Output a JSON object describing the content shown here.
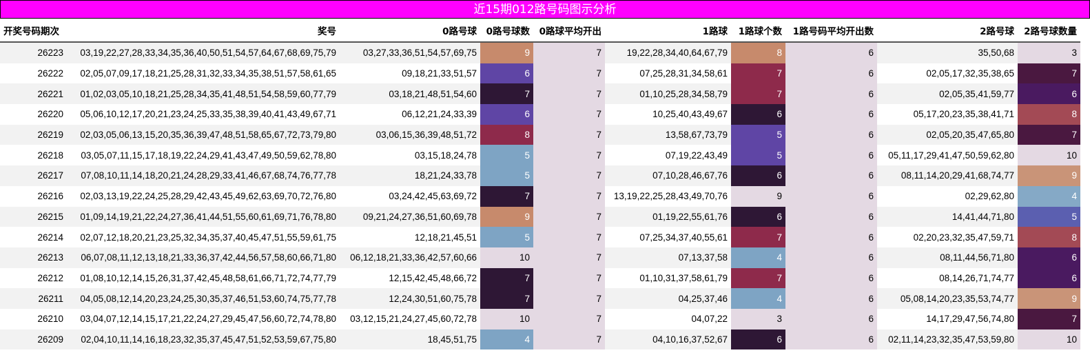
{
  "title": "近15期012路号码图示分析",
  "headers": [
    "开奖号码期次",
    "奖号",
    "0路号球",
    "0路号球数",
    "0路球平均开出",
    "1路球",
    "1路球个数",
    "1路号码平均开出数",
    "2路号球",
    "2路号球数量"
  ],
  "rows": [
    {
      "issue": "26223",
      "numbers": "03,19,22,27,28,33,34,35,36,40,50,51,54,57,64,67,68,69,75,79",
      "r0": "03,27,33,36,51,54,57,69,75",
      "c0": "9",
      "a0": "7",
      "r1": "19,22,28,34,40,64,67,79",
      "c1": "8",
      "a1": "6",
      "r2": "35,50,68",
      "c2": "3"
    },
    {
      "issue": "26222",
      "numbers": "02,05,07,09,17,18,21,25,28,31,32,33,34,35,38,51,57,58,61,65",
      "r0": "09,18,21,33,51,57",
      "c0": "6",
      "a0": "7",
      "r1": "07,25,28,31,34,58,61",
      "c1": "7",
      "a1": "6",
      "r2": "02,05,17,32,35,38,65",
      "c2": "7"
    },
    {
      "issue": "26221",
      "numbers": "01,02,03,05,10,18,21,25,28,34,35,41,48,51,54,58,59,60,77,79",
      "r0": "03,18,21,48,51,54,60",
      "c0": "7",
      "a0": "7",
      "r1": "01,10,25,28,34,58,79",
      "c1": "7",
      "a1": "6",
      "r2": "02,05,35,41,59,77",
      "c2": "6"
    },
    {
      "issue": "26220",
      "numbers": "05,06,10,12,17,20,21,23,24,25,33,35,38,39,40,41,43,49,67,71",
      "r0": "06,12,21,24,33,39",
      "c0": "6",
      "a0": "7",
      "r1": "10,25,40,43,49,67",
      "c1": "6",
      "a1": "6",
      "r2": "05,17,20,23,35,38,41,71",
      "c2": "8"
    },
    {
      "issue": "26219",
      "numbers": "02,03,05,06,13,15,20,35,36,39,47,48,51,58,65,67,72,73,79,80",
      "r0": "03,06,15,36,39,48,51,72",
      "c0": "8",
      "a0": "7",
      "r1": "13,58,67,73,79",
      "c1": "5",
      "a1": "6",
      "r2": "02,05,20,35,47,65,80",
      "c2": "7"
    },
    {
      "issue": "26218",
      "numbers": "03,05,07,11,15,17,18,19,22,24,29,41,43,47,49,50,59,62,78,80",
      "r0": "03,15,18,24,78",
      "c0": "5",
      "a0": "7",
      "r1": "07,19,22,43,49",
      "c1": "5",
      "a1": "6",
      "r2": "05,11,17,29,41,47,50,59,62,80",
      "c2": "10"
    },
    {
      "issue": "26217",
      "numbers": "07,08,10,11,14,18,20,21,24,28,29,33,41,46,67,68,74,76,77,78",
      "r0": "18,21,24,33,78",
      "c0": "5",
      "a0": "7",
      "r1": "07,10,28,46,67,76",
      "c1": "6",
      "a1": "6",
      "r2": "08,11,14,20,29,41,68,74,77",
      "c2": "9"
    },
    {
      "issue": "26216",
      "numbers": "02,03,13,19,22,24,25,28,29,42,43,45,49,62,63,69,70,72,76,80",
      "r0": "03,24,42,45,63,69,72",
      "c0": "7",
      "a0": "7",
      "r1": "13,19,22,25,28,43,49,70,76",
      "c1": "9",
      "a1": "6",
      "r2": "02,29,62,80",
      "c2": "4"
    },
    {
      "issue": "26215",
      "numbers": "01,09,14,19,21,22,24,27,36,41,44,51,55,60,61,69,71,76,78,80",
      "r0": "09,21,24,27,36,51,60,69,78",
      "c0": "9",
      "a0": "7",
      "r1": "01,19,22,55,61,76",
      "c1": "6",
      "a1": "6",
      "r2": "14,41,44,71,80",
      "c2": "5"
    },
    {
      "issue": "26214",
      "numbers": "02,07,12,18,20,21,23,25,32,34,35,37,40,45,47,51,55,59,61,75",
      "r0": "12,18,21,45,51",
      "c0": "5",
      "a0": "7",
      "r1": "07,25,34,37,40,55,61",
      "c1": "7",
      "a1": "6",
      "r2": "02,20,23,32,35,47,59,71",
      "c2": "8"
    },
    {
      "issue": "26213",
      "numbers": "06,07,08,11,12,13,18,21,33,36,37,42,44,56,57,58,60,66,71,80",
      "r0": "06,12,18,21,33,36,42,57,60,66",
      "c0": "10",
      "a0": "7",
      "r1": "07,13,37,58",
      "c1": "4",
      "a1": "6",
      "r2": "08,11,44,56,71,80",
      "c2": "6"
    },
    {
      "issue": "26212",
      "numbers": "01,08,10,12,14,15,26,31,37,42,45,48,58,61,66,71,72,74,77,79",
      "r0": "12,15,42,45,48,66,72",
      "c0": "7",
      "a0": "7",
      "r1": "01,10,31,37,58,61,79",
      "c1": "7",
      "a1": "6",
      "r2": "08,14,26,71,74,77",
      "c2": "6"
    },
    {
      "issue": "26211",
      "numbers": "04,05,08,12,14,20,23,24,25,30,35,37,46,51,53,60,74,75,77,78",
      "r0": "12,24,30,51,60,75,78",
      "c0": "7",
      "a0": "7",
      "r1": "04,25,37,46",
      "c1": "4",
      "a1": "6",
      "r2": "05,08,14,20,23,35,53,74,77",
      "c2": "9"
    },
    {
      "issue": "26210",
      "numbers": "03,04,07,12,14,15,17,21,22,24,27,29,45,47,56,60,72,74,78,80",
      "r0": "03,12,15,21,24,27,45,60,72,78",
      "c0": "10",
      "a0": "7",
      "r1": "04,07,22",
      "c1": "3",
      "a1": "6",
      "r2": "14,17,29,47,56,74,80",
      "c2": "7"
    },
    {
      "issue": "26209",
      "numbers": "02,04,10,11,14,16,18,23,32,35,37,45,47,51,52,53,59,67,75,80",
      "r0": "18,45,51,75",
      "c0": "4",
      "a0": "7",
      "r1": "04,10,16,37,52,67",
      "c1": "6",
      "a1": "6",
      "r2": "02,11,14,23,32,35,47,53,59,80",
      "c2": "10"
    }
  ],
  "colors": {
    "title_bg": "#ff00ff",
    "title_text": "#ffffff",
    "avg_bg": "#e4d9e3",
    "count_scale": {
      "3": "#e4d9e3",
      "4": "#7ea4c4",
      "5": "#7ea4c4",
      "6": "#5f45a5",
      "7": "#2e1735",
      "8": "#8e2a4b",
      "9": "#c78a6c",
      "10": "#e4d9e3"
    }
  },
  "col_overrides": {
    "c1": {
      "4": "#7ea4c4",
      "5": "#5f45a5",
      "6": "#2e1735",
      "7": "#8e2a4b",
      "8": "#c78a6c",
      "9": "#e4d9e3",
      "3": "#e4d9e3"
    },
    "c2": {
      "3": "#e4d9e3",
      "4": "#85a9c6",
      "5": "#5b5fb0",
      "6": "#4a1a60",
      "7": "#4a1840",
      "8": "#a34a55",
      "9": "#c99478",
      "10": "#e4d9e3"
    }
  }
}
